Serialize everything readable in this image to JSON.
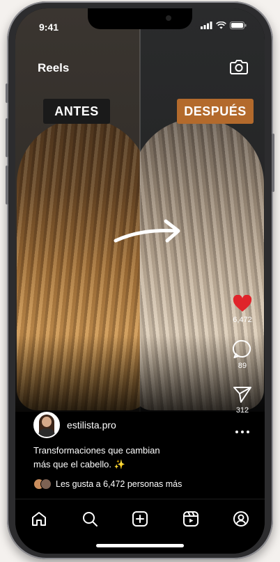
{
  "status_bar": {
    "time": "9:41"
  },
  "header": {
    "title": "Reels"
  },
  "overlay": {
    "before_label": "ANTES",
    "after_label": "DESPUÉS"
  },
  "actions": {
    "likes": "6,472",
    "comments": "89",
    "shares": "312"
  },
  "post": {
    "username": "estilista.pro",
    "caption_line1": "Transformaciones que cambian",
    "caption_line2": "más que el cabello. ✨",
    "likes_text": "Les gusta a 6,472 personas más"
  },
  "colors": {
    "like": "#e0242a",
    "after_badge": "#b36a2c",
    "before_badge": "#1a1a1a"
  },
  "nav": {
    "items": [
      "home-icon",
      "search-icon",
      "add-icon",
      "reels-icon",
      "profile-icon"
    ]
  }
}
